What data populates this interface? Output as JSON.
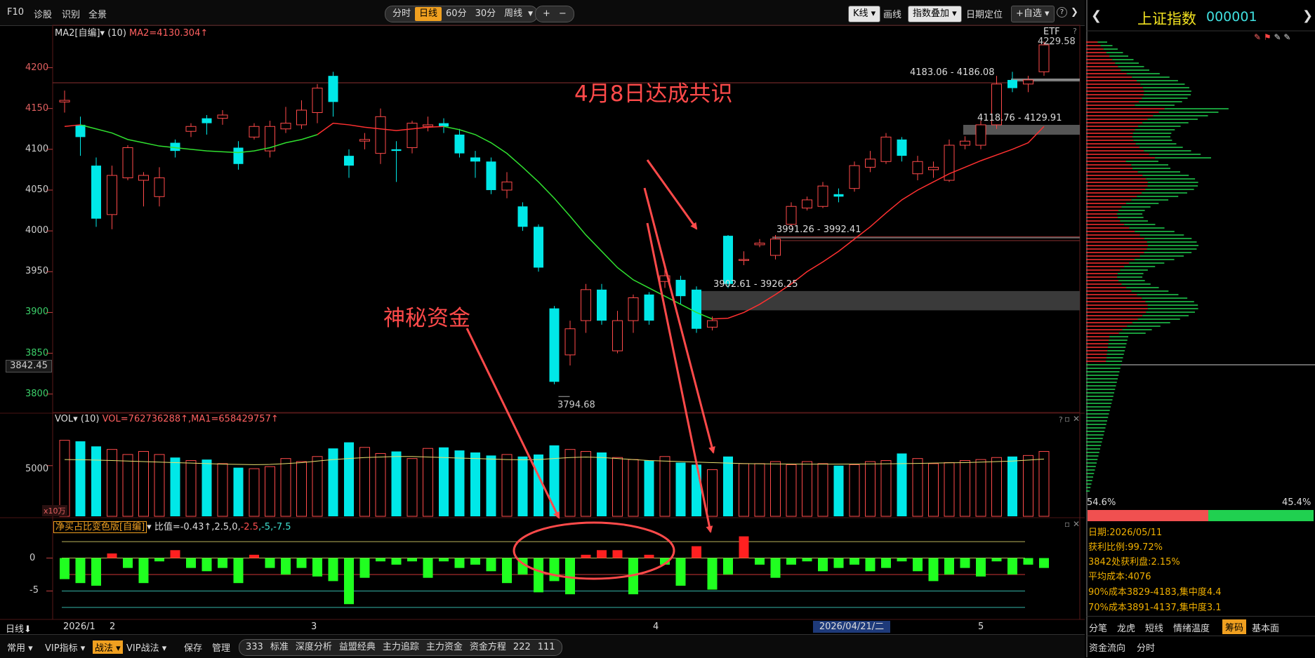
{
  "toolbar": {
    "items": [
      "F10",
      "诊股",
      "识别",
      "全景"
    ],
    "periods": [
      "分时",
      "日线",
      "60分",
      "30分",
      "周线"
    ],
    "active_period": "日线",
    "zoom": [
      "+",
      "−"
    ],
    "right": [
      "K线",
      "画线",
      "指数叠加",
      "日期定位",
      "+自选",
      "?"
    ]
  },
  "main_panel": {
    "indicator": "MA2[自编]",
    "param": "(10)",
    "value": "MA2=4130.304↑",
    "etf": "ETF",
    "cursor_price": "3842.45"
  },
  "vol_panel": {
    "indicator": "VOL",
    "param": "(10)",
    "values": "VOL=762736288↑,MA1=658429757↑",
    "unit": "x10万",
    "ylabel": "5000"
  },
  "net_panel": {
    "indicator": "净买占比变色版[自编]",
    "values_prefix": "比值=-0.43↑,2.5,0,",
    "values_red": "-2.5",
    "values_green": ",-5,-7.5"
  },
  "xaxis": {
    "period": "日线",
    "labels": [
      "2026/1",
      "2",
      "3",
      "4",
      "5"
    ],
    "cursor_date": "2026/04/21/二"
  },
  "annotations": {
    "consensus": "4月8日达成共识",
    "mystery": "神秘资金"
  },
  "chart_data": {
    "type": "candlestick",
    "title": "上证指数",
    "ylim": [
      3780,
      4240
    ],
    "yticks": [
      4200,
      4150,
      4100,
      4050,
      4000,
      3950,
      3900,
      3850,
      3800
    ],
    "candles": [
      [
        4158,
        4160,
        4145,
        4172
      ],
      [
        4130,
        4115,
        4092,
        4140
      ],
      [
        4080,
        4015,
        4005,
        4090
      ],
      [
        4020,
        4068,
        4002,
        4080
      ],
      [
        4065,
        4102,
        4062,
        4105
      ],
      [
        4062,
        4068,
        4030,
        4072
      ],
      [
        4042,
        4065,
        4030,
        4078
      ],
      [
        4108,
        4098,
        4090,
        4112
      ],
      [
        4122,
        4128,
        4115,
        4132
      ],
      [
        4138,
        4132,
        4118,
        4142
      ],
      [
        4138,
        4142,
        4130,
        4148
      ],
      [
        4102,
        4082,
        4075,
        4110
      ],
      [
        4115,
        4128,
        4112,
        4132
      ],
      [
        4098,
        4128,
        4090,
        4135
      ],
      [
        4125,
        4132,
        4120,
        4152
      ],
      [
        4130,
        4148,
        4125,
        4160
      ],
      [
        4145,
        4175,
        4132,
        4180
      ],
      [
        4190,
        4158,
        4140,
        4195
      ],
      [
        4092,
        4080,
        4065,
        4100
      ],
      [
        4110,
        4112,
        4100,
        4120
      ],
      [
        4095,
        4140,
        4082,
        4150
      ],
      [
        4100,
        4098,
        4060,
        4110
      ],
      [
        4102,
        4132,
        4095,
        4135
      ],
      [
        4128,
        4130,
        4122,
        4140
      ],
      [
        4132,
        4128,
        4120,
        4138
      ],
      [
        4118,
        4095,
        4090,
        4125
      ],
      [
        4090,
        4085,
        4065,
        4098
      ],
      [
        4085,
        4050,
        4045,
        4090
      ],
      [
        4050,
        4060,
        4040,
        4072
      ],
      [
        4030,
        4005,
        4000,
        4035
      ],
      [
        4005,
        3955,
        3950,
        4008
      ],
      [
        3905,
        3815,
        3812,
        3908
      ],
      [
        3848,
        3880,
        3835,
        3890
      ],
      [
        3890,
        3928,
        3875,
        3935
      ],
      [
        3928,
        3890,
        3885,
        3935
      ],
      [
        3853,
        3890,
        3850,
        3902
      ],
      [
        3890,
        3918,
        3875,
        3922
      ],
      [
        3922,
        3890,
        3885,
        3925
      ],
      [
        3938,
        3945,
        3930,
        3955
      ],
      [
        3940,
        3920,
        3910,
        3945
      ],
      [
        3928,
        3880,
        3875,
        3932
      ],
      [
        3882,
        3890,
        3878,
        3895
      ],
      [
        3994,
        3935,
        3930,
        3995
      ],
      [
        3965,
        3965,
        3958,
        3975
      ],
      [
        3983,
        3985,
        3980,
        3990
      ],
      [
        3970,
        3990,
        3965,
        3995
      ],
      [
        4008,
        4030,
        4005,
        4035
      ],
      [
        4028,
        4038,
        4025,
        4042
      ],
      [
        4030,
        4055,
        4028,
        4060
      ],
      [
        4045,
        4042,
        4035,
        4052
      ],
      [
        4052,
        4080,
        4048,
        4085
      ],
      [
        4078,
        4088,
        4072,
        4098
      ],
      [
        4085,
        4115,
        4082,
        4120
      ],
      [
        4112,
        4092,
        4085,
        4115
      ],
      [
        4070,
        4085,
        4062,
        4092
      ],
      [
        4075,
        4078,
        4065,
        4085
      ],
      [
        4062,
        4105,
        4060,
        4112
      ],
      [
        4105,
        4110,
        4100,
        4116
      ],
      [
        4105,
        4130,
        4100,
        4135
      ],
      [
        4130,
        4180,
        4125,
        4190
      ],
      [
        4185,
        4175,
        4170,
        4195
      ],
      [
        4180,
        4185,
        4170,
        4190
      ],
      [
        4195,
        4228,
        4190,
        4232
      ]
    ],
    "ma": [
      4128,
      4130,
      4125,
      4120,
      4112,
      4108,
      4104,
      4102,
      4100,
      4098,
      4097,
      4096,
      4098,
      4102,
      4108,
      4112,
      4118,
      4132,
      4130,
      4127,
      4125,
      4123,
      4125,
      4127,
      4128,
      4124,
      4118,
      4108,
      4095,
      4078,
      4060,
      4040,
      4018,
      3995,
      3975,
      3955,
      3940,
      3930,
      3920,
      3910,
      3900,
      3892,
      3893,
      3900,
      3910,
      3922,
      3935,
      3950,
      3962,
      3975,
      3990,
      4005,
      4022,
      4038,
      4050,
      4060,
      4070,
      4078,
      4086,
      4093,
      4100,
      4108,
      4128
    ],
    "ma_break_index": 41,
    "price_zones": [
      {
        "label": "4183.06 - 4186.08",
        "low": 4183.06,
        "high": 4186.08
      },
      {
        "label": "4118.76 - 4129.91",
        "low": 4118.76,
        "high": 4129.91
      },
      {
        "label": "3991.26 - 3992.41",
        "low": 3991.26,
        "high": 3992.41
      },
      {
        "label": "3902.61 - 3926.25",
        "low": 3902.61,
        "high": 3926.25
      }
    ],
    "labels": {
      "high": "4229.58",
      "low": "3794.68"
    },
    "volume": {
      "ylim": [
        0,
        9000
      ],
      "values": [
        7500,
        7400,
        6900,
        6600,
        6100,
        6400,
        6100,
        5800,
        5500,
        5600,
        5200,
        4800,
        4700,
        4900,
        5700,
        5400,
        5900,
        6700,
        7300,
        6800,
        6200,
        6400,
        5700,
        6700,
        6800,
        6500,
        6300,
        6000,
        6100,
        5900,
        6100,
        7000,
        6600,
        6400,
        6300,
        5800,
        5600,
        5500,
        5900,
        5300,
        5100,
        4600,
        5900,
        5200,
        5200,
        5400,
        5100,
        5400,
        5200,
        5000,
        5100,
        5400,
        5500,
        6200,
        5700,
        5200,
        5300,
        5500,
        5600,
        5800,
        5900,
        6000,
        6400
      ],
      "ma": [
        5600,
        5580,
        5550,
        5500,
        5450,
        5400,
        5350,
        5300,
        5250,
        5200,
        5150,
        5120,
        5100,
        5120,
        5200,
        5300,
        5450,
        5600,
        5700,
        5800,
        5850,
        5900,
        5900,
        5850,
        5800,
        5750,
        5700,
        5650,
        5600,
        5580,
        5600,
        5700,
        5800,
        5850,
        5800,
        5700,
        5600,
        5500,
        5450,
        5400,
        5350,
        5300,
        5250,
        5200,
        5180,
        5170,
        5160,
        5150,
        5150,
        5150,
        5160,
        5170,
        5180,
        5200,
        5220,
        5250,
        5280,
        5300,
        5350,
        5400,
        5450,
        5550,
        5650
      ]
    },
    "netbuy": {
      "ylim": [
        -9,
        4
      ],
      "yticks": [
        0,
        -5
      ],
      "levels": [
        2.5,
        0,
        -2.5,
        -5,
        -7.5
      ],
      "values": [
        -3.2,
        -3.8,
        -4.2,
        0.7,
        -1.5,
        -3.8,
        -0.5,
        1.2,
        -1.5,
        -2,
        -1.5,
        -3.8,
        0.5,
        -1.5,
        -2.5,
        -1.5,
        -2.8,
        -3.5,
        -7,
        -3,
        -0.5,
        -1,
        -0.5,
        -3,
        -0.5,
        -1.5,
        -1,
        -2,
        -3.8,
        -2.5,
        -5.2,
        -3.5,
        -5.5,
        0.5,
        1.2,
        1.2,
        -5.5,
        0.5,
        -1,
        -4.2,
        1.8,
        -4.8,
        -2.5,
        3.3,
        -1,
        -3,
        -1,
        -0.5,
        -2,
        -1.5,
        -1,
        -2,
        -1.5,
        -0.5,
        -2,
        -3.5,
        -2.5,
        -1.5,
        -2.8,
        -0.5,
        -2.5,
        -1,
        -1.5,
        -0.5
      ]
    }
  },
  "right_panel": {
    "title": "上证指数",
    "code": "000001",
    "ratio_left": "54.6%",
    "ratio_right": "45.4%",
    "info": [
      "日期:2026/05/11",
      "获利比例:99.72%",
      "3842处获利盘:2.15%",
      "平均成本:4076",
      "90%成本3829-4183,集中度4.4",
      "70%成本3891-4137,集中度3.1"
    ],
    "tabs": [
      "分笔",
      "龙虎",
      "短线",
      "情绪温度",
      "筹码",
      "基本面"
    ],
    "active_tab": "筹码",
    "tabs2": [
      "资金流向",
      "分时"
    ]
  },
  "bottombar": {
    "items": [
      "常用",
      "VIP指标",
      "战法",
      "VIP战法",
      "保存",
      "管理"
    ],
    "group": [
      "333",
      "标准",
      "深度分析",
      "益盟经典",
      "主力追踪",
      "主力资金",
      "资金方程",
      "222",
      "111"
    ],
    "active": "战法"
  }
}
